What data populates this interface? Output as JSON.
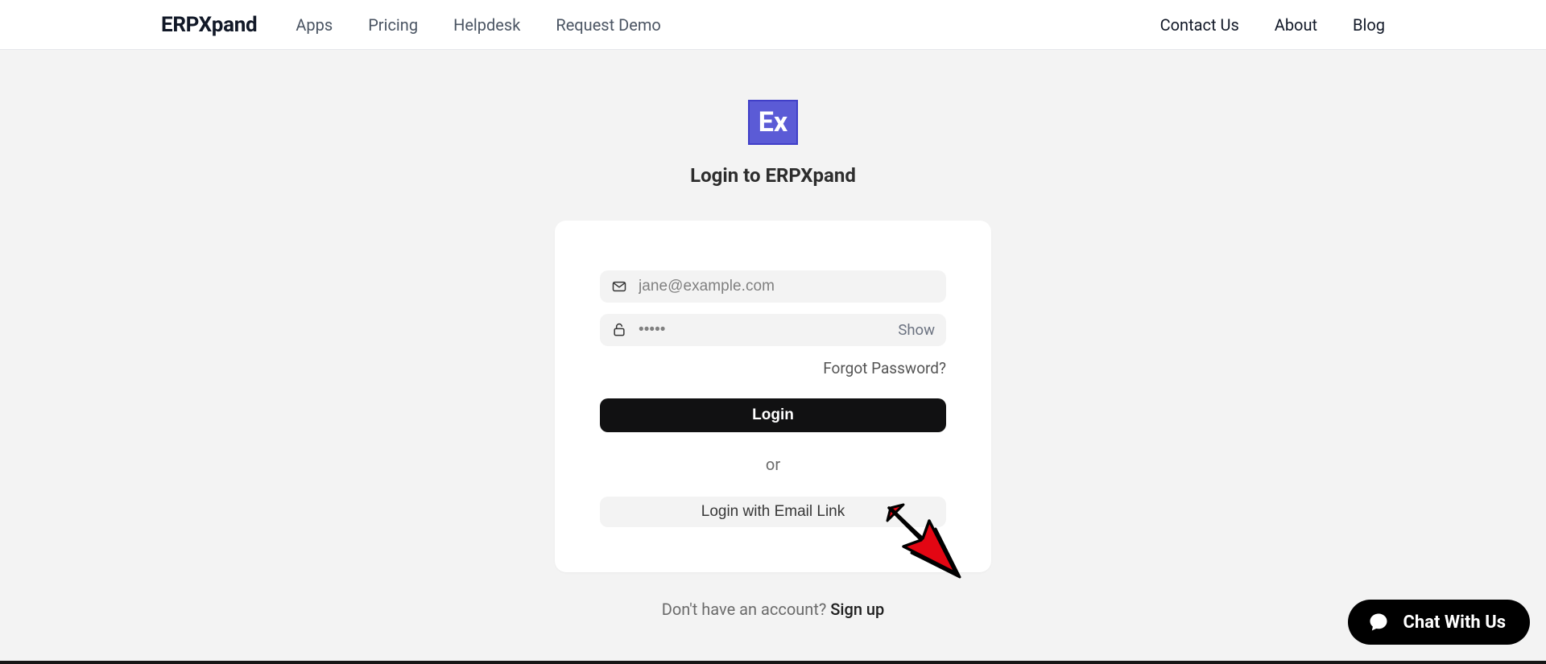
{
  "brand": "ERPXpand",
  "nav": {
    "left": [
      "Apps",
      "Pricing",
      "Helpdesk",
      "Request Demo"
    ],
    "right": [
      "Contact Us",
      "About",
      "Blog"
    ]
  },
  "logo_text": "Ex",
  "page_title": "Login to ERPXpand",
  "form": {
    "email_placeholder": "jane@example.com",
    "email_value": "",
    "password_placeholder": "•••••",
    "password_value": "",
    "show_label": "Show",
    "forgot_label": "Forgot Password?",
    "login_label": "Login",
    "or_label": "or",
    "email_link_label": "Login with Email Link"
  },
  "signup": {
    "prompt": "Don't have an account? ",
    "link_label": "Sign up"
  },
  "chat": {
    "label": "Chat With Us"
  },
  "colors": {
    "accent": "#5b5bd6",
    "arrow": "#e30613"
  }
}
